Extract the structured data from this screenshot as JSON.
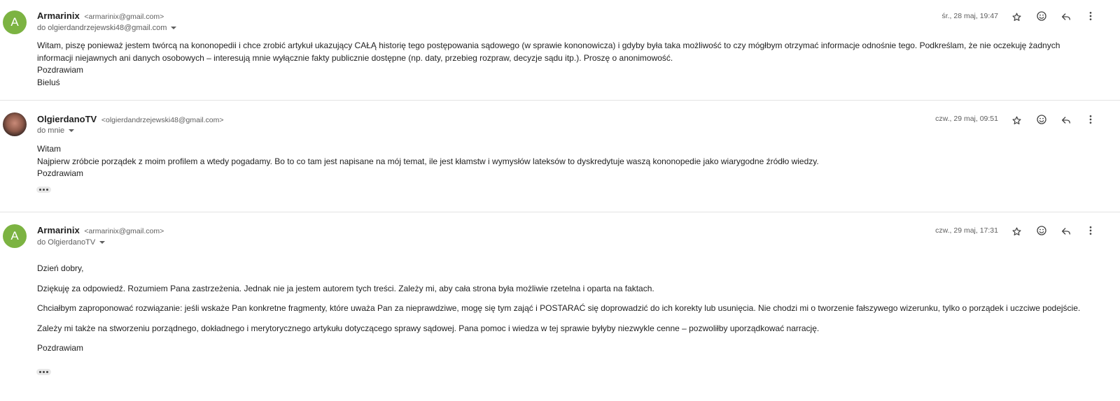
{
  "messages": [
    {
      "avatar_letter": "A",
      "sender_name": "Armarinix",
      "sender_email": "<armarinix@gmail.com>",
      "recipient": "do olgierdandrzejewski48@gmail.com",
      "date": "śr., 28 maj, 19:47",
      "body": [
        "Witam, piszę ponieważ jestem twórcą na kononopedii i chce zrobić artykuł ukazujący CAŁĄ historię tego postępowania sądowego (w sprawie kononowicza) i gdyby była taka możliwość to czy mógłbym otrzymać informacje odnośnie tego. Podkreślam, że nie oczekuję żadnych informacji niejawnych ani danych osobowych – interesują mnie wyłącznie fakty publicznie dostępne (np. daty, przebieg rozpraw, decyzje sądu itp.). Proszę o anonimowość.",
        "Pozdrawiam",
        "Bieluś"
      ]
    },
    {
      "sender_name": "OlgierdanoTV",
      "sender_email": "<olgierdandrzejewski48@gmail.com>",
      "recipient": "do mnie",
      "date": "czw., 29 maj, 09:51",
      "body": [
        "Witam",
        "Najpierw zróbcie porządek z moim profilem a wtedy pogadamy. Bo to co tam jest napisane na mój temat, ile jest kłamstw i wymysłów lateksów to dyskredytuje waszą kononopedie jako wiarygodne źródło wiedzy.",
        "Pozdrawiam"
      ]
    },
    {
      "avatar_letter": "A",
      "sender_name": "Armarinix",
      "sender_email": "<armarinix@gmail.com>",
      "recipient": "do OlgierdanoTV",
      "date": "czw., 29 maj, 17:31",
      "body": [
        "Dzień dobry,",
        "Dziękuję za odpowiedź. Rozumiem Pana zastrzeżenia. Jednak nie ja jestem autorem tych treści. Zależy mi, aby cała strona była możliwie rzetelna i oparta na faktach.",
        "Chciałbym zaproponować rozwiązanie: jeśli wskaże Pan konkretne fragmenty, które uważa Pan za nieprawdziwe, mogę się tym zająć i POSTARAĆ się doprowadzić do ich korekty lub usunięcia. Nie chodzi mi o tworzenie fałszywego wizerunku, tylko o porządek i uczciwe podejście.",
        "Zależy mi także na stworzeniu porządnego, dokładnego i merytorycznego artykułu dotyczącego sprawy sądowej. Pana pomoc i wiedza w tej sprawie byłyby niezwykle cenne –  pozwoliłby uporządkować narrację.",
        "Pozdrawiam"
      ]
    }
  ],
  "icons": {
    "star": "star-icon",
    "emoji": "emoji-icon",
    "reply": "reply-icon",
    "more": "more-vert-icon",
    "expand": "ellipsis-icon",
    "caret": "chevron-down-icon"
  },
  "colors": {
    "avatar_green": "#7cb342",
    "divider": "#e3e3e3",
    "meta_text": "#5e5e5e"
  }
}
